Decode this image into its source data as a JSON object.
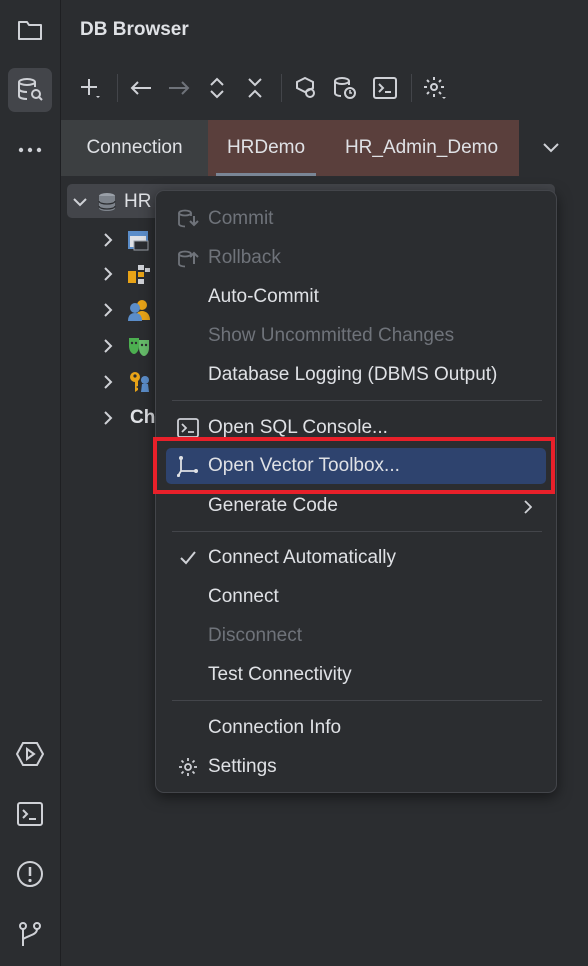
{
  "panel": {
    "title": "DB Browser"
  },
  "tabs": [
    {
      "label": "Connection"
    },
    {
      "label": "HRDemo"
    },
    {
      "label": "HR_Admin_Demo"
    }
  ],
  "tree": {
    "root_label": "HR",
    "partial_child_label": "Ch"
  },
  "context_menu": {
    "items": {
      "commit": "Commit",
      "rollback": "Rollback",
      "auto_commit": "Auto-Commit",
      "show_uncommitted": "Show Uncommitted Changes",
      "db_logging": "Database Logging (DBMS Output)",
      "open_sql_console": "Open SQL Console...",
      "open_vector_toolbox": "Open Vector Toolbox...",
      "generate_code": "Generate Code",
      "connect_automatically": "Connect Automatically",
      "connect": "Connect",
      "disconnect": "Disconnect",
      "test_connectivity": "Test Connectivity",
      "connection_info": "Connection Info",
      "settings": "Settings"
    },
    "highlighted": "open_vector_toolbox",
    "connect_automatically_checked": true
  },
  "colors": {
    "background": "#2b2d30",
    "highlight": "#2e436e",
    "annotation_box": "#e8202a",
    "tab_connection_tint": "#5a3f3c"
  }
}
